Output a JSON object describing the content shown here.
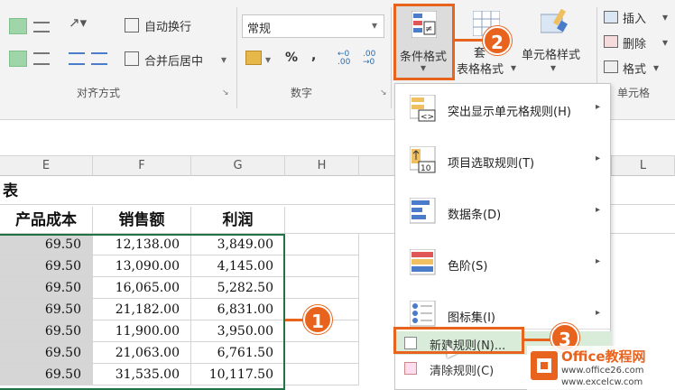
{
  "ribbon": {
    "wrap_text": "自动换行",
    "merge_center": "合并后居中",
    "align_group": "对齐方式",
    "number_format": "常规",
    "percent": "%",
    "comma": ",",
    "dec_inc": "←0 .00",
    "dec_dec": ".00 →0",
    "number_group": "数字",
    "cond_format": "条件格式",
    "table_format": "表格格式",
    "table_top": "套",
    "cell_style": "单元格样式",
    "insert": "插入",
    "delete": "删除",
    "format": "格式",
    "cells_group": "单元格"
  },
  "columns": [
    "E",
    "F",
    "G",
    "H",
    "L"
  ],
  "sheet": {
    "title_fragment": "表",
    "headers": [
      "产品成本",
      "销售额",
      "利润"
    ],
    "rows": [
      [
        "69.50",
        "12,138.00",
        "3,849.00"
      ],
      [
        "69.50",
        "13,090.00",
        "4,145.00"
      ],
      [
        "69.50",
        "16,065.00",
        "5,282.50"
      ],
      [
        "69.50",
        "21,182.00",
        "6,831.00"
      ],
      [
        "69.50",
        "11,900.00",
        "3,950.00"
      ],
      [
        "69.50",
        "21,063.00",
        "6,761.50"
      ],
      [
        "69.50",
        "31,535.00",
        "10,117.50"
      ]
    ]
  },
  "menu": {
    "items": [
      {
        "label": "突出显示单元格规则(H)",
        "arrow": "▸"
      },
      {
        "label": "项目选取规则(T)",
        "arrow": "▸"
      },
      {
        "label": "数据条(D)",
        "arrow": "▸"
      },
      {
        "label": "色阶(S)",
        "arrow": "▸"
      },
      {
        "label": "图标集(I)",
        "arrow": "▸"
      }
    ],
    "new_rule": "新建规则(N)...",
    "clear_rule": "清除规则(C)"
  },
  "callouts": [
    "1",
    "2",
    "3"
  ],
  "watermark": {
    "brand": "Office教程网",
    "url1": "www.office26.com",
    "url2": "www.excelcw.com"
  }
}
